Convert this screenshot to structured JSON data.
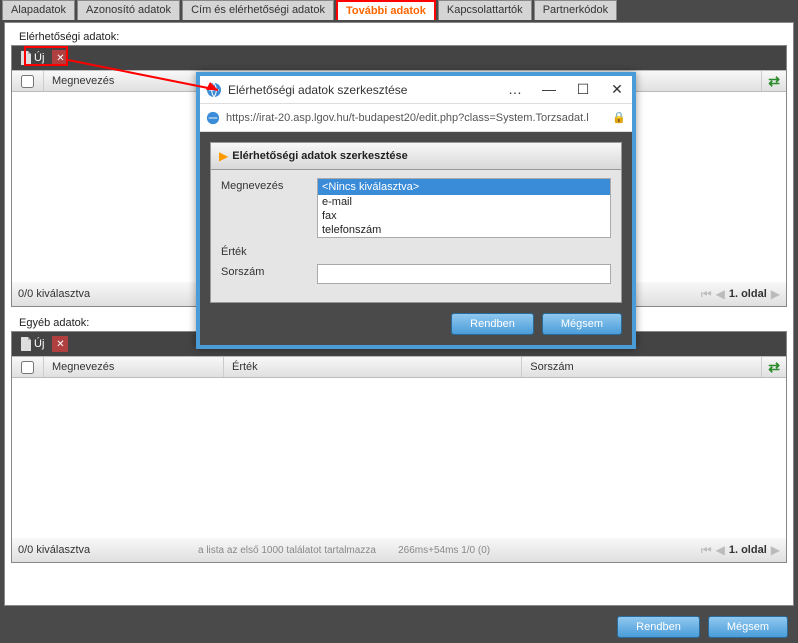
{
  "tabs": {
    "t0": "Alapadatok",
    "t1": "Azonosító adatok",
    "t2": "Cím és elérhetőségi adatok",
    "t3": "További adatok",
    "t4": "Kapcsolattartók",
    "t5": "Partnerkódok"
  },
  "section1": {
    "label": "Elérhetőségi adatok:",
    "toolbar": {
      "new": "Új"
    },
    "header": {
      "col1": "Megnevezés"
    },
    "footer": {
      "left": "0/0 kiválasztva",
      "page": "1. oldal"
    }
  },
  "section2": {
    "label": "Egyéb adatok:",
    "toolbar": {
      "new": "Új"
    },
    "header": {
      "col1": "Megnevezés",
      "col2": "Érték",
      "col3": "Sorszám"
    },
    "footer": {
      "left": "0/0 kiválasztva",
      "mid1": "a lista az első 1000 találatot tartalmazza",
      "mid2": "266ms+54ms 1/0 (0)",
      "page": "1. oldal"
    }
  },
  "buttons": {
    "ok": "Rendben",
    "cancel": "Mégsem"
  },
  "dialog": {
    "title": "Elérhetőségi adatok szerkesztése",
    "url": "https://irat-20.asp.lgov.hu/t-budapest20/edit.php?class=System.Torzsadat.l",
    "heading": "Elérhetőségi adatok szerkesztése",
    "fields": {
      "megnevezes": "Megnevezés",
      "ertek": "Érték",
      "sorszam": "Sorszám"
    },
    "dropdown": {
      "selected": "<Nincs kiválasztva>",
      "opt1": "e-mail",
      "opt2": "fax",
      "opt3": "telefonszám"
    },
    "buttons": {
      "ok": "Rendben",
      "cancel": "Mégsem"
    },
    "more": "…"
  }
}
